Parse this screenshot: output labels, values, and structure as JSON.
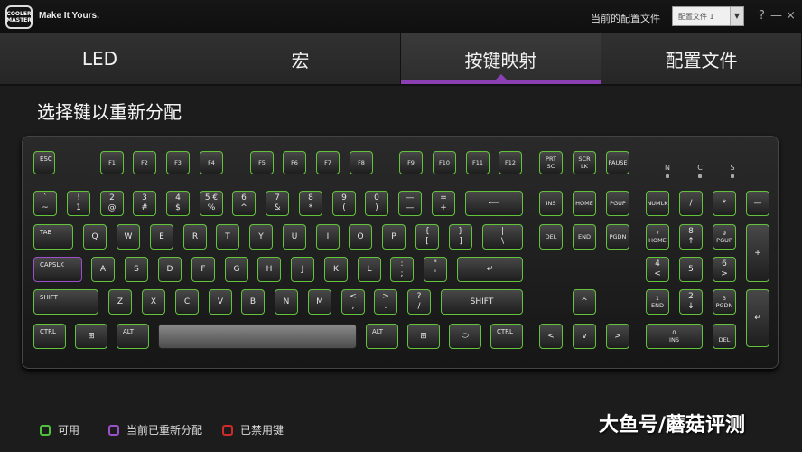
{
  "titlebar": {
    "logo_text": "COOLER MASTER",
    "tagline": "Make It Yours.",
    "profile_label": "当前的配置文件",
    "profile_value": "配置文件 1",
    "help": "?",
    "minimize": "—",
    "close": "×"
  },
  "tabs": [
    {
      "label": "LED"
    },
    {
      "label": "宏"
    },
    {
      "label": "按键映射",
      "active": true
    },
    {
      "label": "配置文件"
    }
  ],
  "section_title": "选择键以重新分配",
  "indicators": [
    {
      "label": "N"
    },
    {
      "label": "C"
    },
    {
      "label": "S"
    }
  ],
  "keys": {
    "esc": "ESC",
    "f1": "F1",
    "f2": "F2",
    "f3": "F3",
    "f4": "F4",
    "f5": "F5",
    "f6": "F6",
    "f7": "F7",
    "f8": "F8",
    "f9": "F9",
    "f10": "F10",
    "f11": "F11",
    "f12": "F12",
    "prtsc": "PRT\nSC",
    "scrlk": "SCR\nLK",
    "pause": "PAUSE",
    "grave": "`\n~",
    "n1": "!\n1",
    "n2": "2\n@",
    "n3": "3\n#",
    "n4": "4\n$",
    "n5": "5 €\n%",
    "n6": "6\n^",
    "n7": "7\n&",
    "n8": "8\n*",
    "n9": "9\n(",
    "n0": "0\n)",
    "minus": "—\n—",
    "equal": "=\n+",
    "bksp": "⟵",
    "ins": "INS",
    "home": "HOME",
    "pgup": "PGUP",
    "numlk": "NUMLK",
    "ndiv": "/",
    "nmul": "*",
    "nsub": "—",
    "tab": "TAB",
    "q": "Q",
    "w": "W",
    "e": "E",
    "r": "R",
    "t": "T",
    "y": "Y",
    "u": "U",
    "i": "I",
    "o": "O",
    "p": "P",
    "lbr": "{\n[",
    "rbr": "}\n]",
    "bslash": "|\n\\",
    "del": "DEL",
    "end": "END",
    "pgdn": "PGDN",
    "n7k": "7\nHOME",
    "n8k": "8\n↑",
    "n9k": "9\nPGUP",
    "nadd": "+",
    "caps": "CAPSLK",
    "a": "A",
    "s": "S",
    "d": "D",
    "f": "F",
    "g": "G",
    "h": "H",
    "j": "J",
    "k": "K",
    "l": "L",
    "semi": ":\n;",
    "quote": "\"\n'",
    "enter": "↵",
    "n4k": "4\n<",
    "n5k": "5",
    "n6k": "6\n>",
    "lshift": "SHIFT",
    "z": "Z",
    "x": "X",
    "c": "C",
    "v": "V",
    "b": "B",
    "n": "N",
    "m": "M",
    "comma": "<\n,",
    "period": ">\n.",
    "slash": "?\n/",
    "rshift": "SHIFT",
    "up": "^",
    "n1k": "1\nEND",
    "n2k": "2\n↓",
    "n3k": "3\nPGDN",
    "nenter": "↵",
    "lctrl": "CTRL",
    "lwin": "⊞",
    "lalt": "ALT",
    "space": "",
    "ralt": "ALT",
    "rwin": "⊞",
    "fn": "⬭",
    "rctrl": "CTRL",
    "left": "<",
    "down": "v",
    "right": ">",
    "n0k": "0\nINS",
    "ndel": ".\nDEL"
  },
  "legend": [
    {
      "label": "可用",
      "color": "#4fc13a"
    },
    {
      "label": "当前已重新分配",
      "color": "#9b4fc9"
    },
    {
      "label": "已禁用键",
      "color": "#d02a2a"
    }
  ],
  "watermark": "大鱼号/蘑菇评测"
}
